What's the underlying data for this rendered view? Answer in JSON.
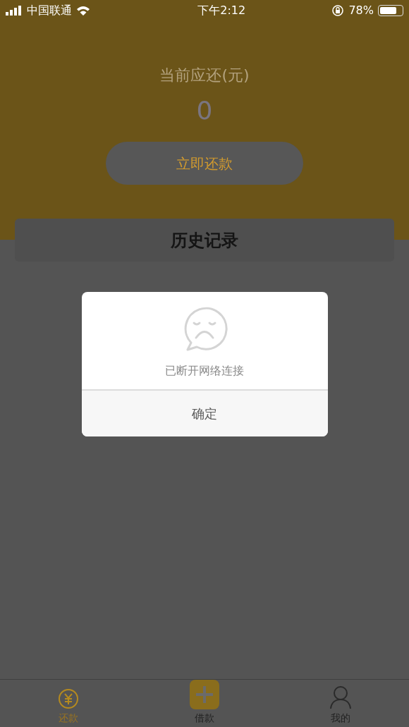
{
  "status_bar": {
    "carrier": "中国联通",
    "time": "下午2:12",
    "battery_percent": "78%",
    "battery": {
      "level": 0.78
    }
  },
  "header": {
    "label": "当前应还(元)",
    "amount": "0",
    "button": "立即还款"
  },
  "history": {
    "title": "历史记录"
  },
  "dialog": {
    "message": "已断开网络连接",
    "button": "确定"
  },
  "tabs": [
    {
      "label": "还款",
      "kind": "yuan",
      "selected": true
    },
    {
      "label": "借款",
      "kind": "plus",
      "selected": false
    },
    {
      "label": "我的",
      "kind": "person",
      "selected": false
    }
  ]
}
